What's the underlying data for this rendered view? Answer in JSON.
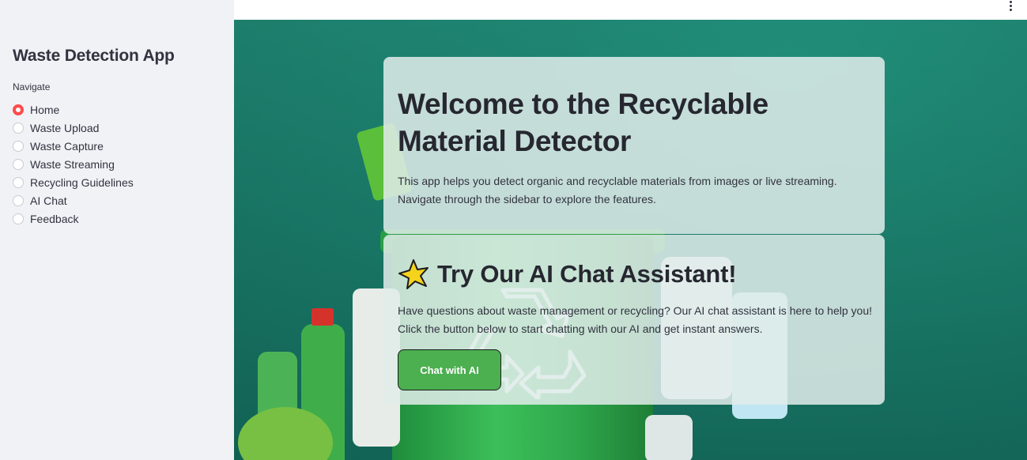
{
  "sidebar": {
    "title": "Waste Detection App",
    "nav_label": "Navigate",
    "items": [
      {
        "label": "Home",
        "selected": true
      },
      {
        "label": "Waste Upload",
        "selected": false
      },
      {
        "label": "Waste Capture",
        "selected": false
      },
      {
        "label": "Waste Streaming",
        "selected": false
      },
      {
        "label": "Recycling Guidelines",
        "selected": false
      },
      {
        "label": "AI Chat",
        "selected": false
      },
      {
        "label": "Feedback",
        "selected": false
      }
    ]
  },
  "header": {
    "menu_icon": "more-vertical-icon"
  },
  "main": {
    "welcome": {
      "title": "Welcome to the Recyclable Material Detector",
      "description": "This app helps you detect organic and recyclable materials from images or live streaming. Navigate through the sidebar to explore the features."
    },
    "ai_chat": {
      "icon": "star-icon",
      "title": "Try Our AI Chat Assistant!",
      "description": "Have questions about waste management or recycling? Our AI chat assistant is here to help you! Click the button below to start chatting with our AI and get instant answers.",
      "button_label": "Chat with AI"
    }
  },
  "colors": {
    "accent": "#ff4b4b",
    "button": "#4caf50",
    "sidebar_bg": "#f0f2f6",
    "background_teal": "#1a7a68"
  }
}
